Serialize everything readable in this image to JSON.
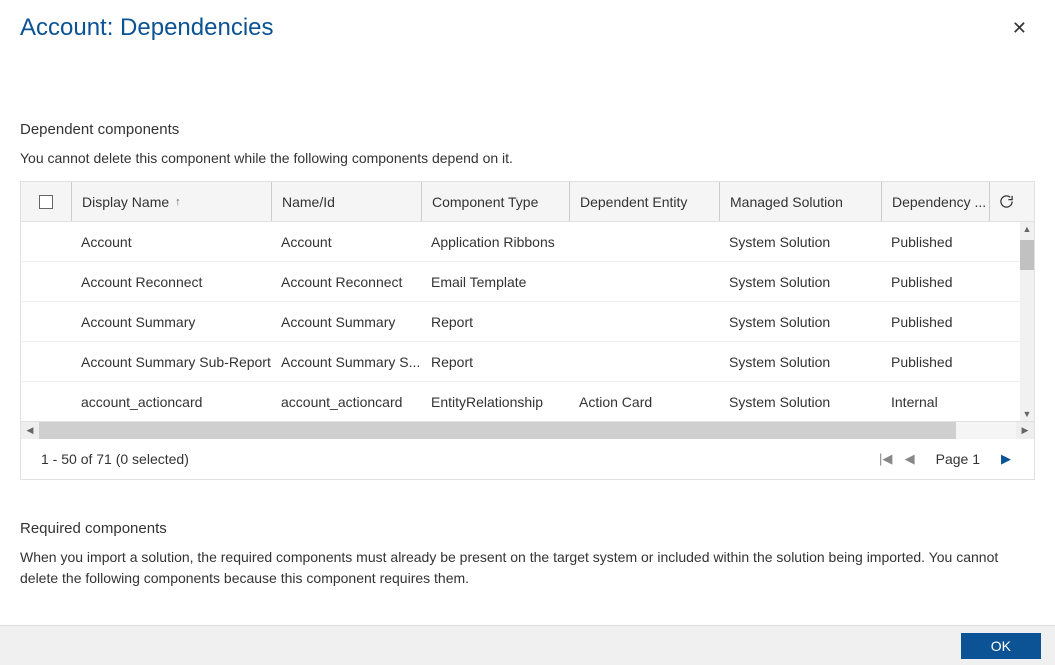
{
  "dialog": {
    "title": "Account: Dependencies",
    "close": "✕"
  },
  "dependent": {
    "title": "Dependent components",
    "desc": "You cannot delete this component while the following components depend on it."
  },
  "columns": {
    "display_name": "Display Name",
    "name_id": "Name/Id",
    "component_type": "Component Type",
    "dependent_entity": "Dependent Entity",
    "managed_solution": "Managed Solution",
    "dependency_type": "Dependency ..."
  },
  "rows": [
    {
      "display": "Account",
      "nameid": "Account",
      "comptype": "Application Ribbons",
      "depent": "",
      "managed": "System Solution",
      "deptype": "Published"
    },
    {
      "display": "Account Reconnect",
      "nameid": "Account Reconnect",
      "comptype": "Email Template",
      "depent": "",
      "managed": "System Solution",
      "deptype": "Published"
    },
    {
      "display": "Account Summary",
      "nameid": "Account Summary",
      "comptype": "Report",
      "depent": "",
      "managed": "System Solution",
      "deptype": "Published"
    },
    {
      "display": "Account Summary Sub-Report",
      "nameid": "Account Summary S...",
      "comptype": "Report",
      "depent": "",
      "managed": "System Solution",
      "deptype": "Published"
    },
    {
      "display": "account_actioncard",
      "nameid": "account_actioncard",
      "comptype": "EntityRelationship",
      "depent": "Action Card",
      "managed": "System Solution",
      "deptype": "Internal"
    }
  ],
  "pager": {
    "status": "1 - 50 of 71 (0 selected)",
    "page": "Page 1"
  },
  "required": {
    "title": "Required components",
    "desc": "When you import a solution, the required components must already be present on the target system or included within the solution being imported. You cannot delete the following components because this component requires them."
  },
  "footer": {
    "ok": "OK"
  }
}
